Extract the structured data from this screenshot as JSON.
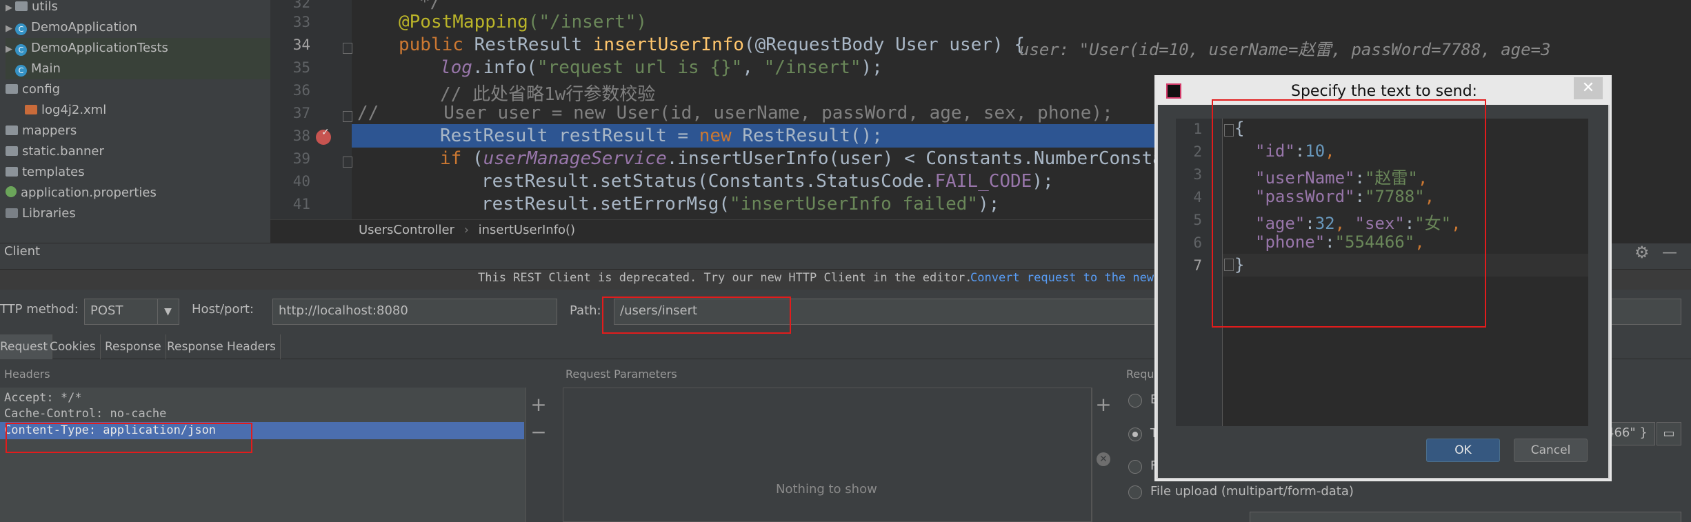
{
  "project_tree": {
    "items": [
      {
        "label": "utils",
        "icon": "folder-icon"
      },
      {
        "label": "DemoApplication",
        "icon": "class-icon"
      },
      {
        "label": "DemoApplicationTests",
        "icon": "class-icon"
      },
      {
        "label": "Main",
        "icon": "class-icon"
      },
      {
        "label": "config",
        "icon": "folder-icon"
      },
      {
        "label": "log4j2.xml",
        "icon": "xml-file-icon"
      },
      {
        "label": "mappers",
        "icon": "folder-icon"
      },
      {
        "label": "static.banner",
        "icon": "folder-icon"
      },
      {
        "label": "templates",
        "icon": "folder-icon"
      },
      {
        "label": "application.properties",
        "icon": "properties-icon"
      },
      {
        "label": "Libraries",
        "icon": "libraries-icon"
      }
    ]
  },
  "editor": {
    "line_numbers": [
      "32",
      "33",
      "34",
      "35",
      "36",
      "37",
      "38",
      "39",
      "40",
      "41"
    ],
    "lines": {
      "l32": "*/",
      "l33_ann": "@PostMapping",
      "l33_str": "(\"/insert\")",
      "l34_kw": "public ",
      "l34_type": "RestResult ",
      "l34_fn": "insertUserInfo",
      "l34_rest": "(@RequestBody User user) {",
      "l34_hint": "user: \"User(id=10, userName=赵雷, passWord=7788, age=3",
      "l35_fld": "log",
      "l35_a": ".info(",
      "l35_s1": "\"request url is {}\"",
      "l35_b": ", ",
      "l35_s2": "\"/insert\"",
      "l35_c": ");",
      "l36": "// 此处省略1w行参数校验",
      "l37": "//      User user = new User(id, userName, passWord, age, sex, phone);",
      "l38_a": "RestResult restResult = ",
      "l38_kw": "new ",
      "l38_b": "RestResult();",
      "l39_kw": "if ",
      "l39_a": "(",
      "l39_fld": "userManageService",
      "l39_b": ".insertUserInfo(user) < Constants.NumberConstants",
      "l40_a": "restResult.setStatus(Constants.StatusCode.",
      "l40_it": "FAIL_CODE",
      "l40_b": ");",
      "l41_a": "restResult.setErrorMsg(",
      "l41_str": "\"insertUserInfo failed\"",
      "l41_b": ");"
    },
    "breadcrumb": [
      "UsersController",
      "insertUserInfo()"
    ]
  },
  "rest_client": {
    "title": "Client",
    "notice_text": "This REST Client is deprecated. Try our new HTTP Client in the editor.",
    "notice_link": "Convert request to the new",
    "http_method_label": "TTP method:",
    "http_method_value": "POST",
    "host_label": "Host/port:",
    "host_value": "http://localhost:8080",
    "path_label": "Path:",
    "path_value": "/users/insert",
    "tabs": [
      "Request",
      "Cookies",
      "Response",
      "Response Headers"
    ],
    "headers_title": "Headers",
    "headers": [
      "Accept: */*",
      "Cache-Control: no-cache",
      "Content-Type: application/json"
    ],
    "params_title": "Request Parameters",
    "params_empty": "Nothing to show",
    "body_title": "Reque",
    "body_options": [
      "E",
      "T",
      "F",
      "File upload (multipart/form-data)"
    ],
    "body_preview": "466\" }"
  },
  "dialog": {
    "title": "Specify the text to send:",
    "line_numbers": [
      "1",
      "2",
      "3",
      "4",
      "5",
      "6",
      "7"
    ],
    "json_lines": {
      "open": "{",
      "k1": "\"id\"",
      "v1": "10",
      "k2": "\"userName\"",
      "v2": "\"赵雷\"",
      "k3": "\"passWord\"",
      "v3": "\"7788\"",
      "k4": "\"age\"",
      "v4": "32",
      "k5": "\"sex\"",
      "v5": "\"女\"",
      "k6": "\"phone\"",
      "v6": "\"554466\"",
      "close": "}"
    },
    "ok_label": "OK",
    "cancel_label": "Cancel"
  },
  "colors": {
    "highlight_red": "#e21c1c",
    "breakpoint_line": "#2d5592",
    "selected_row": "#4b6eaf"
  }
}
